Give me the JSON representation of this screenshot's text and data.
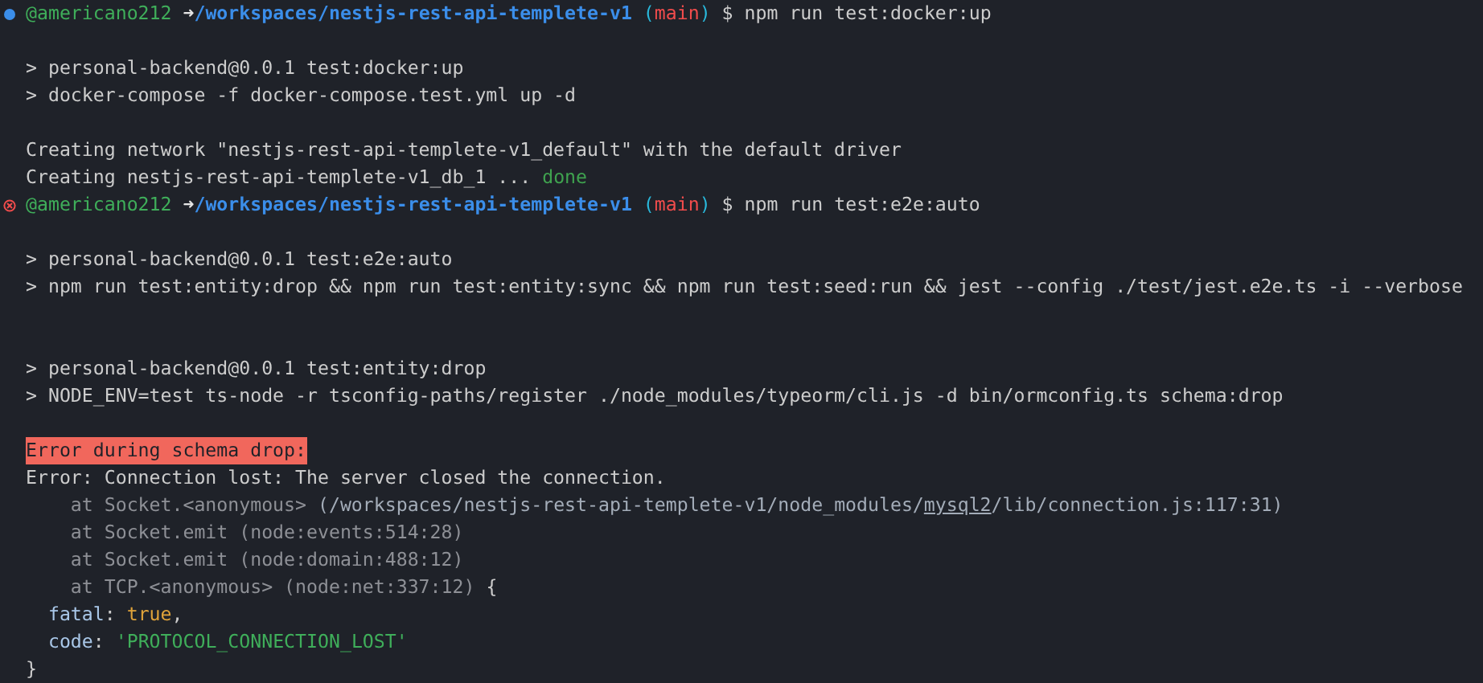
{
  "terminal": {
    "lines": [
      {
        "kind": "prompt",
        "failed": false,
        "segments": [
          {
            "text": "@americano212",
            "kind": "user"
          },
          {
            "text": " ➜",
            "kind": "arrow"
          },
          {
            "text": "/workspaces/nestjs-rest-api-templete-v1",
            "kind": "path"
          },
          {
            "text": " (",
            "kind": "paren"
          },
          {
            "text": "main",
            "kind": "branch"
          },
          {
            "text": ")",
            "kind": "paren"
          },
          {
            "text": " $ npm run test:docker:up",
            "kind": "plain"
          }
        ]
      },
      {
        "kind": "blank"
      },
      {
        "kind": "output",
        "segments": [
          {
            "text": "> personal-backend@0.0.1 test:docker:up",
            "kind": "plain"
          }
        ]
      },
      {
        "kind": "output",
        "segments": [
          {
            "text": "> docker-compose -f docker-compose.test.yml up -d",
            "kind": "plain"
          }
        ]
      },
      {
        "kind": "blank"
      },
      {
        "kind": "output",
        "segments": [
          {
            "text": "Creating network \"nestjs-rest-api-templete-v1_default\" with the default driver",
            "kind": "plain"
          }
        ]
      },
      {
        "kind": "output",
        "segments": [
          {
            "text": "Creating nestjs-rest-api-templete-v1_db_1 ... ",
            "kind": "plain"
          },
          {
            "text": "done",
            "kind": "done"
          }
        ]
      },
      {
        "kind": "prompt",
        "failed": true,
        "segments": [
          {
            "text": "@americano212",
            "kind": "user"
          },
          {
            "text": " ➜",
            "kind": "arrow"
          },
          {
            "text": "/workspaces/nestjs-rest-api-templete-v1",
            "kind": "path"
          },
          {
            "text": " (",
            "kind": "paren"
          },
          {
            "text": "main",
            "kind": "branch"
          },
          {
            "text": ")",
            "kind": "paren"
          },
          {
            "text": " $ npm run test:e2e:auto",
            "kind": "plain"
          }
        ]
      },
      {
        "kind": "blank"
      },
      {
        "kind": "output",
        "segments": [
          {
            "text": "> personal-backend@0.0.1 test:e2e:auto",
            "kind": "plain"
          }
        ]
      },
      {
        "kind": "output",
        "segments": [
          {
            "text": "> npm run test:entity:drop && npm run test:entity:sync && npm run test:seed:run && jest --config ./test/jest.e2e.ts -i --verbose",
            "kind": "plain"
          }
        ]
      },
      {
        "kind": "blank"
      },
      {
        "kind": "blank"
      },
      {
        "kind": "output",
        "segments": [
          {
            "text": "> personal-backend@0.0.1 test:entity:drop",
            "kind": "plain"
          }
        ]
      },
      {
        "kind": "output",
        "segments": [
          {
            "text": "> NODE_ENV=test ts-node -r tsconfig-paths/register ./node_modules/typeorm/cli.js -d bin/ormconfig.ts schema:drop",
            "kind": "plain"
          }
        ]
      },
      {
        "kind": "blank"
      },
      {
        "kind": "output",
        "segments": [
          {
            "text": "Error during schema drop:",
            "kind": "error"
          }
        ]
      },
      {
        "kind": "output",
        "segments": [
          {
            "text": "Error: Connection lost: The server closed the connection.",
            "kind": "plain"
          }
        ]
      },
      {
        "kind": "output",
        "segments": [
          {
            "text": "    at Socket.<anonymous> ",
            "kind": "dim"
          },
          {
            "text": "(/workspaces/nestjs-rest-api-templete-v1/node_modules/",
            "kind": "trace"
          },
          {
            "text": "mysql2",
            "kind": "link"
          },
          {
            "text": "/lib/connection.js:117:31)",
            "kind": "trace"
          }
        ]
      },
      {
        "kind": "output",
        "segments": [
          {
            "text": "    at Socket.emit (node:events:514:28)",
            "kind": "dim"
          }
        ]
      },
      {
        "kind": "output",
        "segments": [
          {
            "text": "    at Socket.emit (node:domain:488:12)",
            "kind": "dim"
          }
        ]
      },
      {
        "kind": "output",
        "segments": [
          {
            "text": "    at TCP.<anonymous> (node:net:337:12) ",
            "kind": "dim"
          },
          {
            "text": "{",
            "kind": "plain"
          }
        ]
      },
      {
        "kind": "output",
        "segments": [
          {
            "text": "  fatal",
            "kind": "key"
          },
          {
            "text": ": ",
            "kind": "plain"
          },
          {
            "text": "true",
            "kind": "bool"
          },
          {
            "text": ",",
            "kind": "plain"
          }
        ]
      },
      {
        "kind": "output",
        "segments": [
          {
            "text": "  code",
            "kind": "key"
          },
          {
            "text": ": ",
            "kind": "plain"
          },
          {
            "text": "'PROTOCOL_CONNECTION_LOST'",
            "kind": "string"
          }
        ]
      },
      {
        "kind": "output",
        "segments": [
          {
            "text": "}",
            "kind": "plain"
          }
        ]
      }
    ]
  }
}
